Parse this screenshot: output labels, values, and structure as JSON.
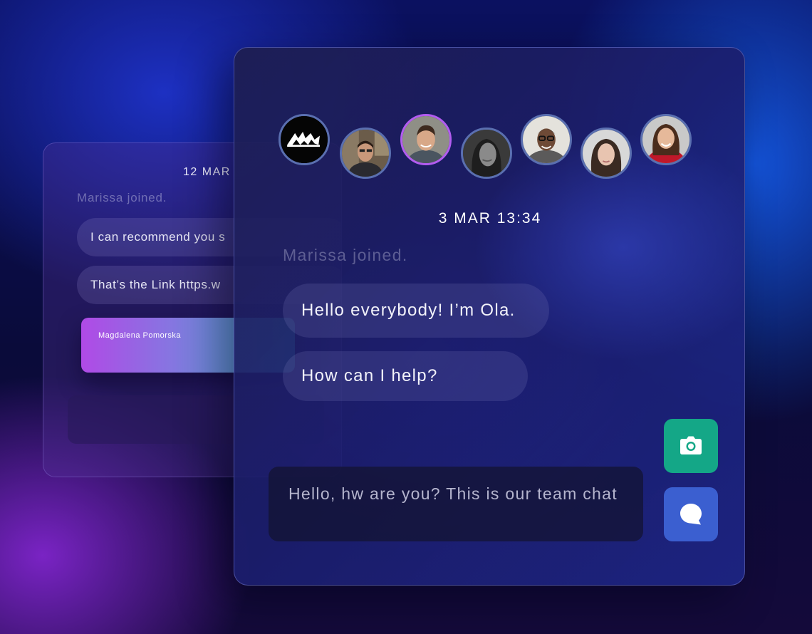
{
  "colors": {
    "accent_green": "#14a787",
    "accent_blue": "#3b5fd0",
    "active_ring": "#b25cf0",
    "avatar_ring": "#5a6fb0"
  },
  "back_chat": {
    "date": "12 MAR",
    "joined": "Marissa joined.",
    "messages": [
      "I can recommend you s",
      "That’s the Link https.w"
    ],
    "card": {
      "name": "Magdalena Pomorska"
    }
  },
  "front_chat": {
    "avatars": [
      {
        "icon": "brand-logo-icon",
        "active": false
      },
      {
        "icon": "user-avatar",
        "active": false
      },
      {
        "icon": "user-avatar",
        "active": true
      },
      {
        "icon": "user-avatar",
        "active": false
      },
      {
        "icon": "user-avatar",
        "active": false
      },
      {
        "icon": "user-avatar",
        "active": false
      },
      {
        "icon": "user-avatar",
        "active": false
      }
    ],
    "date": "3 MAR 13:34",
    "joined": "Marissa joined.",
    "messages": [
      "Hello everybody! I’m Ola.",
      "How can I help?"
    ],
    "compose": {
      "value": "Hello, hw are you? This is our team chat"
    },
    "buttons": {
      "camera": {
        "icon": "camera-icon"
      },
      "chat": {
        "icon": "chat-bubble-icon"
      }
    }
  }
}
